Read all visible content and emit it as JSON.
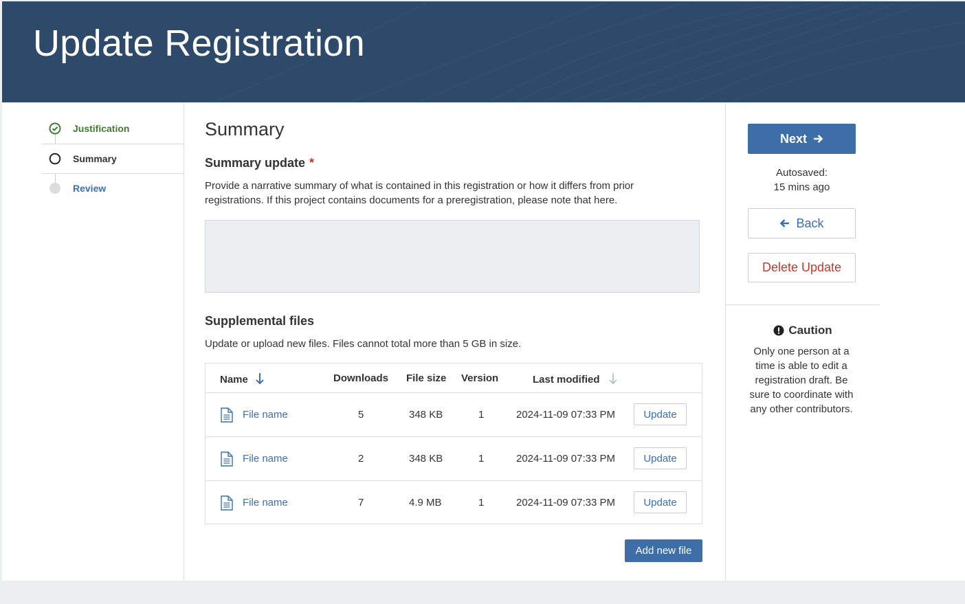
{
  "header": {
    "title": "Update Registration"
  },
  "steps": [
    {
      "label": "Justification",
      "state": "complete",
      "color": "#3f7b2e"
    },
    {
      "label": "Summary",
      "state": "active",
      "color": "#333333"
    },
    {
      "label": "Review",
      "state": "pending",
      "color": "#3a6fb0"
    }
  ],
  "main": {
    "heading": "Summary",
    "summary_update": {
      "label": "Summary update",
      "required_mark": "*",
      "description": "Provide a narrative summary of what is contained in this registration or how it differs from prior registrations. If this project contains documents for a preregistration, please note that here.",
      "value": ""
    },
    "supplemental": {
      "label": "Supplemental files",
      "description": "Update or upload new files. Files cannot total more than 5 GB in size.",
      "columns": [
        "Name",
        "Downloads",
        "File size",
        "Version",
        "Last modified"
      ],
      "rows": [
        {
          "name": "File name",
          "downloads": "5",
          "size": "348 KB",
          "version": "1",
          "modified": "2024-11-09 07:33 PM",
          "action": "Update"
        },
        {
          "name": "File name",
          "downloads": "2",
          "size": "348 KB",
          "version": "1",
          "modified": "2024-11-09 07:33 PM",
          "action": "Update"
        },
        {
          "name": "File name",
          "downloads": "7",
          "size": "4.9 MB",
          "version": "1",
          "modified": "2024-11-09 07:33 PM",
          "action": "Update"
        }
      ],
      "add_button": "Add new file"
    }
  },
  "sidebar_right": {
    "next_label": "Next",
    "autosaved_label": "Autosaved:",
    "autosaved_time": "15 mins ago",
    "back_label": "Back",
    "delete_label": "Delete Update",
    "caution_title": "Caution",
    "caution_text": "Only one person at a time is able to edit a registration draft. Be sure to coordinate with any other contributors."
  },
  "colors": {
    "header_bg": "#2d4a6b",
    "primary": "#3d6ea8",
    "link": "#3a6fb0",
    "danger": "#c0392b",
    "success": "#3f7b2e"
  }
}
